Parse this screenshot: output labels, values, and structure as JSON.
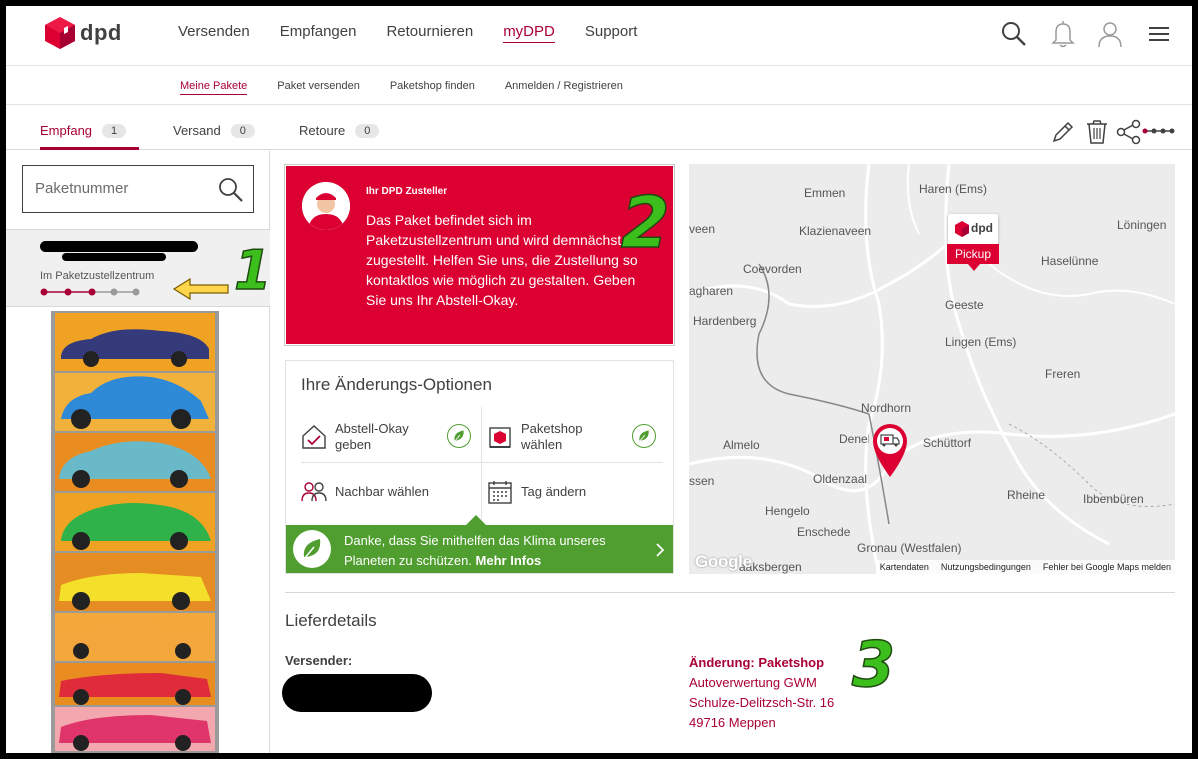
{
  "brand": {
    "name": "dpd",
    "primary_color": "#dc0032",
    "accent_color": "#a90034",
    "green": "#509e2f"
  },
  "main_nav": {
    "items": [
      "Versenden",
      "Empfangen",
      "Retournieren",
      "myDPD",
      "Support"
    ],
    "active": "myDPD",
    "icons": [
      "search-icon",
      "bell-icon",
      "user-icon",
      "menu-icon"
    ]
  },
  "sub_nav": {
    "items": [
      "Meine Pakete",
      "Paket versenden",
      "Paketshop finden",
      "Anmelden / Registrieren"
    ],
    "active": "Meine Pakete"
  },
  "tabs": [
    {
      "label": "Empfang",
      "count": "1",
      "active": true
    },
    {
      "label": "Versand",
      "count": "0"
    },
    {
      "label": "Retoure",
      "count": "0"
    }
  ],
  "tab_icons": [
    "edit-icon",
    "trash-icon",
    "share-icon",
    "progress-icon"
  ],
  "search": {
    "placeholder": "Paketnummer"
  },
  "package": {
    "status": "Im Paketzustellzentrum",
    "steps_total": 5,
    "steps_done": 3
  },
  "zusteller": {
    "label": "Ihr DPD Zusteller",
    "message": "Das Paket befindet sich im Paketzustellzentrum und wird demnächst zugestellt. Helfen Sie uns, die Zustellung so kontaktlos wie möglich zu gestalten. Geben Sie uns Ihr Abstell-Okay."
  },
  "options": {
    "title": "Ihre Änderungs-Optionen",
    "items": [
      {
        "label": "Abstell-Okay geben",
        "icon": "house-check-icon",
        "green": true
      },
      {
        "label": "Paketshop wählen",
        "icon": "parcelshop-icon",
        "green": true
      },
      {
        "label": "Nachbar wählen",
        "icon": "neighbors-icon",
        "green": false
      },
      {
        "label": "Tag ändern",
        "icon": "calendar-icon",
        "green": false
      }
    ],
    "climate_text": "Danke, dass Sie mithelfen das Klima unseres Planeten zu schützen.",
    "climate_link": "Mehr Infos"
  },
  "map": {
    "places": [
      "Emmen",
      "Haren (Ems)",
      "Klazienaveen",
      "Löningen",
      "veen",
      "Haselünne",
      "Coevorden",
      "Geeste",
      "agharen",
      "Hardenberg",
      "Lingen (Ems)",
      "Freren",
      "Nordhorn",
      "Almelo",
      "Denekamp",
      "Schüttorf",
      "Oldenzaal",
      "ssen",
      "Rheine",
      "Ibbenbüren",
      "Hengelo",
      "Enschede",
      "Gronau (Westfalen)",
      "aaksbergen"
    ],
    "pickup_brand": "dpd",
    "pickup_label": "Pickup",
    "footer": [
      "Kartendaten",
      "Nutzungsbedingungen",
      "Fehler bei Google Maps melden"
    ],
    "google_logo": "Google"
  },
  "lieferdetails": {
    "title": "Lieferdetails",
    "sender_label": "Versender:",
    "change_label": "Änderung: Paketshop",
    "address_lines": [
      "Autoverwertung GWM",
      "Schulze-Delitzsch-Str. 16",
      "49716 Meppen"
    ]
  },
  "annotations": [
    "1",
    "2",
    "3"
  ]
}
